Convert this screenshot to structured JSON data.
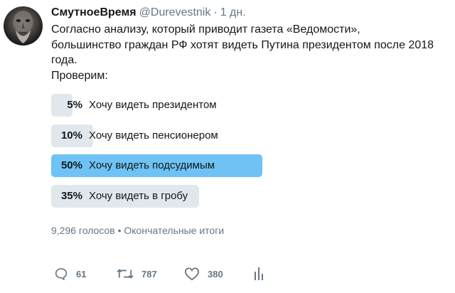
{
  "tweet": {
    "display_name": "СмутноеВремя",
    "handle": "@Durevestnik",
    "separator": "·",
    "time": "1 дн.",
    "text_lines": [
      "Согласно анализу, который приводит газета «Ведомости»,",
      "большинство граждан РФ хотят видеть Путина президентом после 2018",
      "года.",
      "Проверим:"
    ]
  },
  "poll": {
    "options": [
      {
        "percent_label": "5%",
        "label": "Хочу видеть президентом",
        "percent": 5
      },
      {
        "percent_label": "10%",
        "label": "Хочу видеть пенсионером",
        "percent": 10
      },
      {
        "percent_label": "50%",
        "label": "Хочу видеть подсудимым",
        "percent": 50,
        "winner": true
      },
      {
        "percent_label": "35%",
        "label": "Хочу видеть в гробу",
        "percent": 35
      }
    ],
    "meta": "9,296 голосов • Окончательные итоги"
  },
  "actions": {
    "replies": "61",
    "retweets": "787",
    "likes": "380"
  },
  "colors": {
    "bar": "#e1e8ed",
    "winner_bar": "#6ec3f4",
    "secondary_text": "#657786"
  },
  "icons": [
    "reply-icon",
    "retweet-icon",
    "like-icon",
    "analytics-icon"
  ]
}
